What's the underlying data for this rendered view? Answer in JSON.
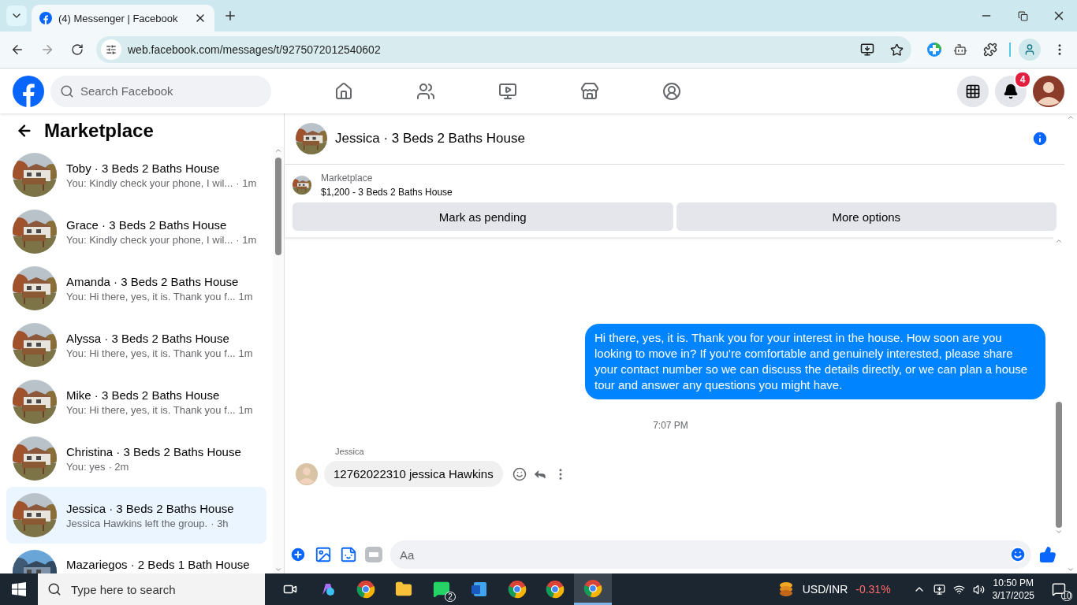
{
  "browser": {
    "tab": {
      "title": "(4) Messenger | Facebook",
      "selected": true
    },
    "url": "web.facebook.com/messages/t/9275072012540602"
  },
  "header": {
    "search": {
      "placeholder": "Search Facebook"
    },
    "notifications": "4"
  },
  "sidebar": {
    "title": "Marketplace",
    "conversations": [
      {
        "name": "Toby · 3 Beds 2 Baths House",
        "preview": "You: Kindly check your phone, I wil...",
        "time": "· 1m",
        "selected": false
      },
      {
        "name": "Grace · 3 Beds 2 Baths House",
        "preview": "You: Kindly check your phone, I wil...",
        "time": "· 1m",
        "selected": false
      },
      {
        "name": "Amanda · 3 Beds 2 Baths House",
        "preview": "You: Hi there, yes, it is. Thank you f...",
        "time": "1m",
        "selected": false
      },
      {
        "name": "Alyssa · 3 Beds 2 Baths House",
        "preview": "You: Hi there, yes, it is. Thank you f...",
        "time": "1m",
        "selected": false
      },
      {
        "name": "Mike · 3 Beds 2 Baths House",
        "preview": "You: Hi there, yes, it is. Thank you f...",
        "time": "1m",
        "selected": false
      },
      {
        "name": "Christina · 3 Beds 2 Baths House",
        "preview": "You: yes",
        "time": "· 2m",
        "selected": false
      },
      {
        "name": "Jessica · 3 Beds 2 Baths House",
        "preview": "Jessica Hawkins left the group.",
        "time": "· 3h",
        "selected": true
      },
      {
        "name": "Mazariegos · 2 Beds 1 Bath House",
        "selected": false
      }
    ]
  },
  "chat": {
    "title": "Jessica · 3 Beds 2 Baths House",
    "listing": {
      "label": "Marketplace",
      "title": "$1,200 - 3 Beds 2 Baths House"
    },
    "buttons": [
      "Mark as pending",
      "More options"
    ],
    "messages": [
      {
        "kind": "outgoing",
        "text": "Hi there, yes, it is. Thank you for your interest in the house. How soon are you looking to move in? If you're comfortable and genuinely interested, please share your contact number so we can discuss the details directly, or we can plan a house tour and answer any questions you might have."
      },
      {
        "kind": "time",
        "text": "7:07 PM"
      },
      {
        "kind": "incoming",
        "sender": "Jessica",
        "text": "12762022310 jessica Hawkins"
      }
    ],
    "composer": {
      "placeholder": "Aa"
    }
  },
  "taskbar": {
    "search": {
      "placeholder": "Type here to search"
    },
    "whatsapp_badge": "2",
    "ticker": {
      "name": "USD/INR",
      "change": "-0.31%"
    },
    "time": "10:50 PM",
    "date": "3/17/2025",
    "notifications": "10"
  }
}
